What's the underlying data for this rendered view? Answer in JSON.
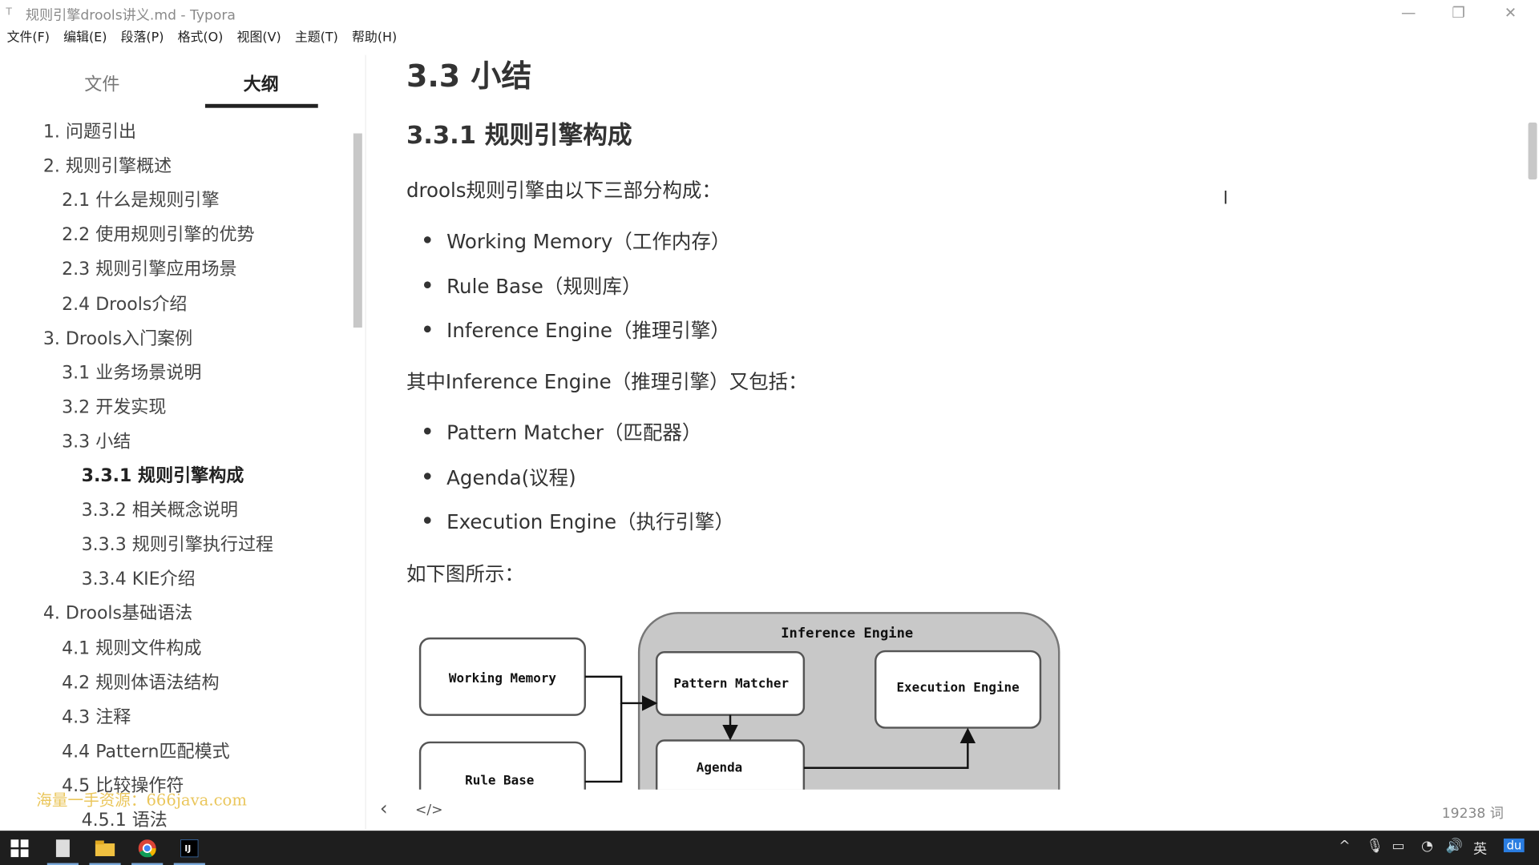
{
  "window": {
    "title": "规则引擎drools讲义.md - Typora",
    "app_icon": "T",
    "minimize": "—",
    "restore": "❐",
    "close": "✕"
  },
  "menu": [
    "文件(F)",
    "编辑(E)",
    "段落(P)",
    "格式(O)",
    "视图(V)",
    "主题(T)",
    "帮助(H)"
  ],
  "sidebar": {
    "tabs": [
      "文件",
      "大纲"
    ],
    "active_tab": "大纲",
    "outline": [
      {
        "label": "1. 问题引出",
        "level": 1
      },
      {
        "label": "2. 规则引擎概述",
        "level": 1
      },
      {
        "label": "2.1 什么是规则引擎",
        "level": 2
      },
      {
        "label": "2.2 使用规则引擎的优势",
        "level": 2
      },
      {
        "label": "2.3 规则引擎应用场景",
        "level": 2
      },
      {
        "label": "2.4 Drools介绍",
        "level": 2
      },
      {
        "label": "3. Drools入门案例",
        "level": 1
      },
      {
        "label": "3.1 业务场景说明",
        "level": 2
      },
      {
        "label": "3.2 开发实现",
        "level": 2
      },
      {
        "label": "3.3 小结",
        "level": 2
      },
      {
        "label": "3.3.1 规则引擎构成",
        "level": 3,
        "active": true
      },
      {
        "label": "3.3.2 相关概念说明",
        "level": 3
      },
      {
        "label": "3.3.3 规则引擎执行过程",
        "level": 3
      },
      {
        "label": "3.3.4 KIE介绍",
        "level": 3
      },
      {
        "label": "4. Drools基础语法",
        "level": 1
      },
      {
        "label": "4.1 规则文件构成",
        "level": 2
      },
      {
        "label": "4.2 规则体语法结构",
        "level": 2
      },
      {
        "label": "4.3 注释",
        "level": 2
      },
      {
        "label": "4.4 Pattern匹配模式",
        "level": 2
      },
      {
        "label": "4.5 比较操作符",
        "level": 2
      },
      {
        "label": "4.5.1 语法",
        "level": 3
      }
    ],
    "watermark": "海量一手资源：666java.com"
  },
  "document": {
    "h2": "3.3 小结",
    "h3": "3.3.1 规则引擎构成",
    "p1": "drools规则引擎由以下三部分构成：",
    "list1": [
      "Working Memory（工作内存）",
      "Rule Base（规则库）",
      "Inference Engine（推理引擎）"
    ],
    "p2": "其中Inference Engine（推理引擎）又包括：",
    "list2": [
      "Pattern Matcher（匹配器）",
      "Agenda(议程)",
      "Execution Engine（执行引擎）"
    ],
    "p3": "如下图所示：",
    "diagram": {
      "container": "Inference Engine",
      "working_memory": "Working Memory",
      "rule_base": "Rule Base",
      "pattern_matcher": "Pattern Matcher",
      "agenda": "Agenda",
      "execution_engine": "Execution Engine"
    }
  },
  "footer": {
    "back_icon": "‹",
    "source_icon": "</>",
    "word_count": "19238 词"
  },
  "taskbar": {
    "tray": {
      "chevron": "^",
      "ime": "英",
      "baidu": "du"
    }
  }
}
